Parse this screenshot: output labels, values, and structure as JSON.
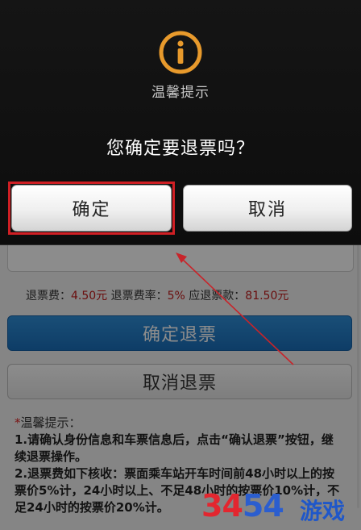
{
  "dialog": {
    "title": "温馨提示",
    "message": "您确定要退票吗？",
    "ok_label": "确定",
    "cancel_label": "取消"
  },
  "fees": {
    "fee_label": "退票费：",
    "fee_value": "4.50元",
    "rate_label": "退票费率：",
    "rate_value": "5%",
    "refund_label": "应退票款：",
    "refund_value": "81.50元"
  },
  "actions": {
    "confirm_refund": "确定退票",
    "cancel_refund": "取消退票"
  },
  "tips": {
    "star": "*",
    "title": "温馨提示：",
    "line1": "1.请确认身份信息和车票信息后，点击“确认退票”按钮，继续退票操作。",
    "line2a": "2.退票费如下核收：票面乘车站开车时间前",
    "line2b": "48小时以上的按票价5%计，24小时以上、不足48小时的按票价10%计，不足24小时的按票价20%计。"
  },
  "watermark": {
    "digits": [
      "3",
      "4",
      "5",
      "4"
    ],
    "text": "游戏"
  },
  "colors": {
    "highlight": "#d01f24",
    "icon_orange": "#e89a2c",
    "confirm_blue": "#1a6fbb",
    "fee_red": "#c21a1a"
  },
  "icons": {
    "dialog_icon": "info-circle-icon"
  }
}
